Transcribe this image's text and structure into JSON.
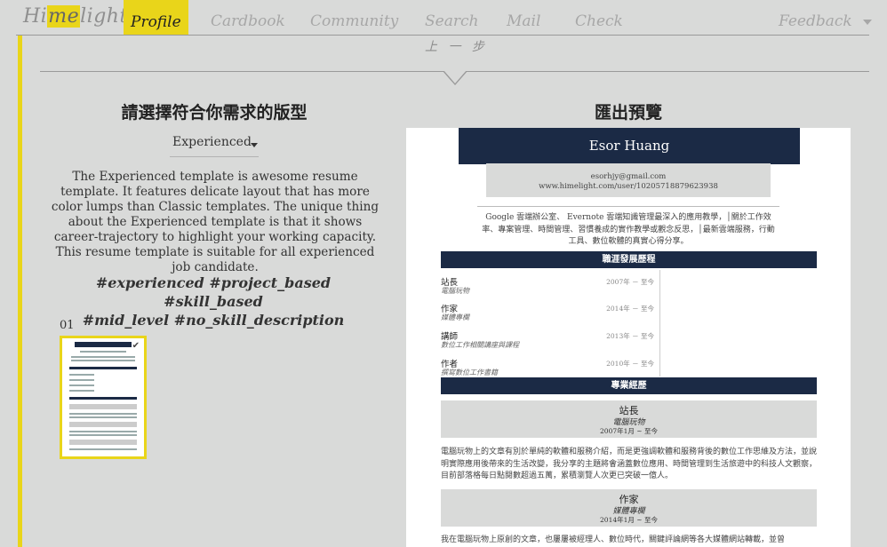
{
  "nav": {
    "logo_pre": "Hi",
    "logo_hl": "me",
    "logo_post": "light",
    "items": [
      "Profile",
      "Cardbook",
      "Community",
      "Search",
      "Mail",
      "Check"
    ],
    "feedback": "Feedback"
  },
  "prev_step": "上 一 步",
  "left": {
    "title": "請選擇符合你需求的版型",
    "select_value": "Experienced",
    "description": "The Experienced template is awesome resume template. It features delicate layout that has more color lumps than Classic templates. The unique thing about the Experienced template is that it shows career-trajectory to highlight your working capacity. This resume template is suitable for all experienced job candidate.",
    "tags_line1": "#experienced #project_based #skill_based",
    "tags_line2": "#mid_level #no_skill_description",
    "thumb_number": "01"
  },
  "right": {
    "title": "匯出預覽"
  },
  "resume": {
    "name": "Esor Huang",
    "email": "esorhjy@gmail.com",
    "url": "www.himelight.com/user/10205718879623938",
    "about": "Google 雲端辦公室、 Evernote 雲端知識管理最深入的應用教學，│關於工作效率、專案管理、時間管理、習慣養成的實作教學或觀念反思，│最新雲端服務，行動工具、數位軟體的真實心得分享。",
    "career_band": "職涯發展歷程",
    "career": [
      {
        "title": "站長",
        "sub": "電腦玩物",
        "date": "2007年 － 至今"
      },
      {
        "title": "作家",
        "sub": "媒體專欄",
        "date": "2014年 － 至今"
      },
      {
        "title": "講師",
        "sub": "數位工作相關講座與課程",
        "date": "2013年 － 至今"
      },
      {
        "title": "作者",
        "sub": "撰寫數位工作書籍",
        "date": "2010年 － 至今"
      }
    ],
    "experience_band": "專業經歷",
    "experience": [
      {
        "title": "站長",
        "sub": "電腦玩物",
        "date": "2007年1月 ~ 至今",
        "para": "電腦玩物上的文章有別於單純的軟體和服務介紹，而是更強調軟體和服務背後的數位工作思維及方法，並說明實際應用後帶來的生活改變，我分享的主題將會涵蓋數位應用、時間管理到生活旅遊中的科技人文觀察，目前部落格每日點閱數超過五萬，累積瀏覽人次更已突破一億人。"
      },
      {
        "title": "作家",
        "sub": "媒體專欄",
        "date": "2014年1月 ~ 至今",
        "para": "我在電腦玩物上原創的文章，也屢屢被經理人、數位時代，關鍵評論網等各大媒體網站轉載，並曾"
      }
    ]
  }
}
